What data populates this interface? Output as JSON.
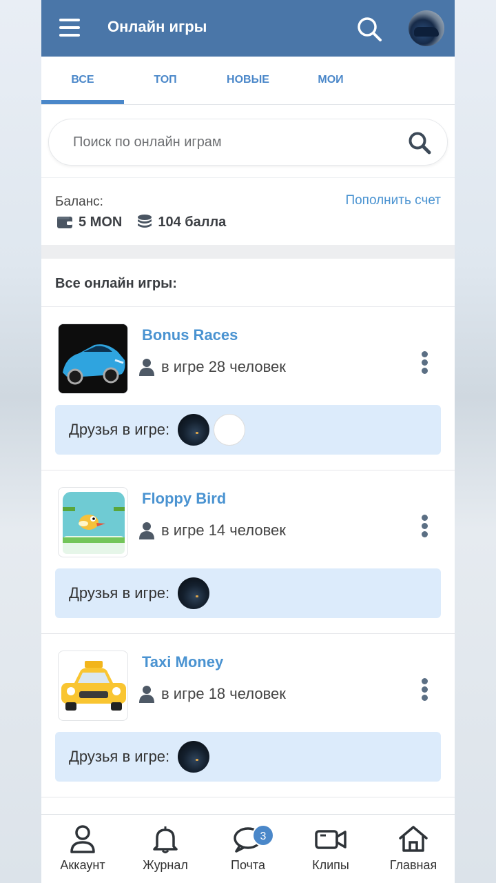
{
  "header": {
    "title": "Онлайн игры",
    "menu_icon": "hamburger-icon",
    "search_icon": "search-icon",
    "accent_color": "#4a76a8"
  },
  "tabs": [
    {
      "label": "ВСЕ",
      "active": true
    },
    {
      "label": "ТОП",
      "active": false
    },
    {
      "label": "НОВЫЕ",
      "active": false
    },
    {
      "label": "МОИ",
      "active": false
    }
  ],
  "search": {
    "placeholder": "Поиск по онлайн играм",
    "value": ""
  },
  "balance": {
    "label": "Баланс:",
    "topup_label": "Пополнить счет",
    "money": "5 MON",
    "points": "104 балла"
  },
  "games_section": {
    "title": "Все онлайн игры:",
    "games": [
      {
        "name": "Bonus Races",
        "players": "в игре 28 человек",
        "friends_label": "Друзья в игре:",
        "friends_count": 2
      },
      {
        "name": "Floppy Bird",
        "players": "в игре 14 человек",
        "friends_label": "Друзья в игре:",
        "friends_count": 1
      },
      {
        "name": "Taxi Money",
        "players": "в игре 18 человек",
        "friends_label": "Друзья в игре:",
        "friends_count": 1
      }
    ]
  },
  "bottom_nav": {
    "items": [
      {
        "label": "Аккаунт",
        "icon": "user-icon"
      },
      {
        "label": "Журнал",
        "icon": "bell-icon"
      },
      {
        "label": "Почта",
        "icon": "chat-icon",
        "badge": "3"
      },
      {
        "label": "Клипы",
        "icon": "video-camera-icon"
      },
      {
        "label": "Главная",
        "icon": "home-icon"
      }
    ]
  }
}
